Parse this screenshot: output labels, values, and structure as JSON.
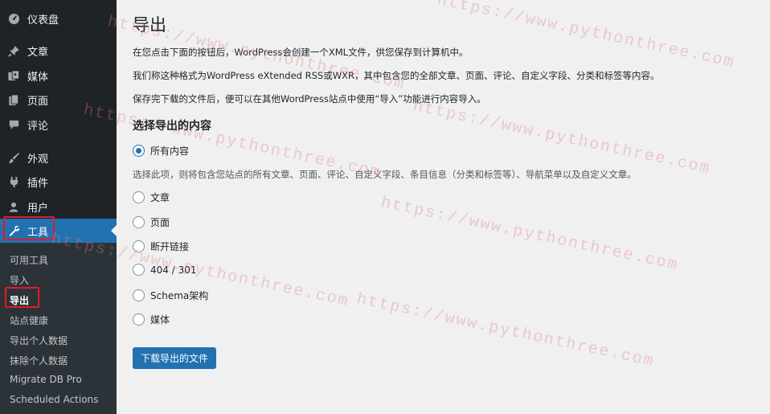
{
  "sidebar": {
    "dashboard": {
      "label": "仪表盘",
      "icon": "dashboard-icon"
    },
    "posts": {
      "label": "文章",
      "icon": "pushpin-icon"
    },
    "media": {
      "label": "媒体",
      "icon": "media-icon"
    },
    "pages": {
      "label": "页面",
      "icon": "page-icon"
    },
    "comments": {
      "label": "评论",
      "icon": "comment-icon"
    },
    "appearance": {
      "label": "外观",
      "icon": "brush-icon"
    },
    "plugins": {
      "label": "插件",
      "icon": "plugin-icon"
    },
    "users": {
      "label": "用户",
      "icon": "user-icon"
    },
    "tools": {
      "label": "工具",
      "icon": "wrench-icon"
    },
    "submenu": [
      {
        "label": "可用工具"
      },
      {
        "label": "导入"
      },
      {
        "label": "导出"
      },
      {
        "label": "站点健康"
      },
      {
        "label": "导出个人数据"
      },
      {
        "label": "抹除个人数据"
      },
      {
        "label": "Migrate DB Pro"
      },
      {
        "label": "Scheduled Actions"
      }
    ]
  },
  "main": {
    "title": "导出",
    "desc1": "在您点击下面的按钮后，WordPress会创建一个XML文件，供您保存到计算机中。",
    "desc2": "我们称这种格式为WordPress eXtended RSS或WXR，其中包含您的全部文章、页面、评论、自定义字段、分类和标签等内容。",
    "desc3": "保存完下载的文件后，便可以在其他WordPress站点中使用“导入”功能进行内容导入。",
    "section_title": "选择导出的内容",
    "options": [
      {
        "label": "所有内容",
        "checked": true
      },
      {
        "label": "文章",
        "checked": false
      },
      {
        "label": "页面",
        "checked": false
      },
      {
        "label": "断开链接",
        "checked": false
      },
      {
        "label": "404 / 301",
        "checked": false
      },
      {
        "label": "Schema架构",
        "checked": false
      },
      {
        "label": "媒体",
        "checked": false
      }
    ],
    "hint": "选择此项，则将包含您站点的所有文章、页面、评论、自定义字段、条目信息（分类和标签等）、导航菜单以及自定义文章。",
    "button_label": "下载导出的文件"
  },
  "watermark": "https://www.pythonthree.com",
  "colors": {
    "sidebar_bg": "#1d2327",
    "submenu_bg": "#2c3338",
    "accent": "#2271b1",
    "highlight": "#e31b23",
    "content_bg": "#f0f0f1"
  }
}
